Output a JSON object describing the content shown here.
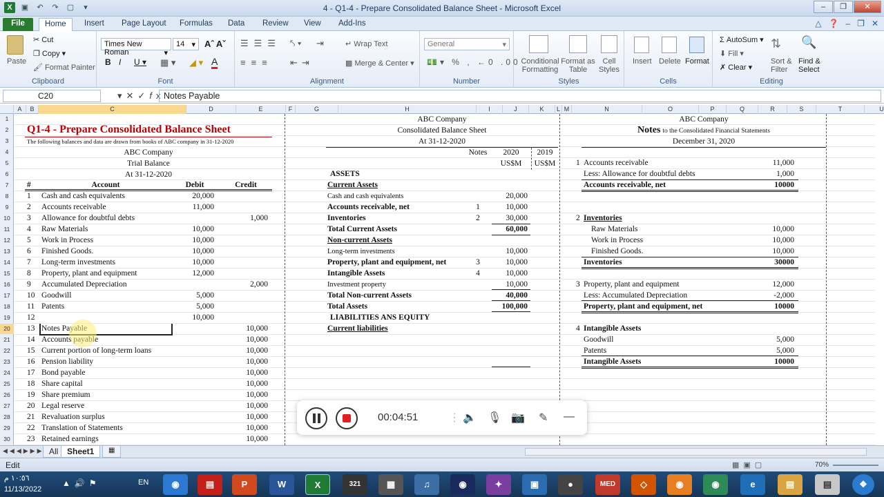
{
  "window": {
    "title": "4 - Q1-4 - Prepare Consolidated Balance Sheet  -  Microsoft Excel"
  },
  "tabs": [
    "File",
    "Home",
    "Insert",
    "Page Layout",
    "Formulas",
    "Data",
    "Review",
    "View",
    "Add-Ins"
  ],
  "ribbon": {
    "clipboard": {
      "label": "Clipboard",
      "paste": "Paste",
      "cut": "Cut",
      "copy": "Copy",
      "format_painter": "Format Painter"
    },
    "font": {
      "label": "Font",
      "name": "Times New Roman",
      "size": "14"
    },
    "alignment": {
      "label": "Alignment",
      "wrap_text": "Wrap Text",
      "merge_center": "Merge & Center"
    },
    "number": {
      "label": "Number",
      "format": "General"
    },
    "styles": {
      "label": "Styles",
      "conditional": "Conditional Formatting",
      "format_table": "Format as Table",
      "cell_styles": "Cell Styles"
    },
    "cells": {
      "label": "Cells",
      "insert": "Insert",
      "delete": "Delete",
      "format": "Format"
    },
    "editing": {
      "label": "Editing",
      "autosum": "AutoSum",
      "fill": "Fill",
      "clear": "Clear",
      "sort": "Sort & Filter",
      "find": "Find & Select"
    }
  },
  "formula_bar": {
    "name_box": "C20",
    "content": "Notes Payable"
  },
  "columns": [
    "A",
    "B",
    "C",
    "D",
    "E",
    "F",
    "G",
    "H",
    "I",
    "J",
    "K",
    "L",
    "M",
    "N",
    "O",
    "P",
    "Q",
    "R",
    "S",
    "T",
    "U"
  ],
  "rows": [
    "1",
    "2",
    "3",
    "4",
    "5",
    "6",
    "7",
    "8",
    "9",
    "10",
    "11",
    "12",
    "13",
    "14",
    "15",
    "16",
    "17",
    "18",
    "19",
    "20",
    "21",
    "22",
    "23",
    "24",
    "25",
    "26",
    "27",
    "28",
    "29",
    "30"
  ],
  "trial_balance": {
    "title": "Q1-4 - Prepare Consolidated Balance Sheet",
    "subtitle": "The following balances and data are drawn from books of ABC company in 31-12-2020",
    "company": "ABC Company",
    "heading": "Trial Balance",
    "date": "At 31-12-2020",
    "headers": {
      "num": "#",
      "account": "Account",
      "debit": "Debit",
      "credit": "Credit"
    },
    "rows": [
      {
        "n": "1",
        "account": "Cash and cash equivalents",
        "debit": "20,000",
        "credit": ""
      },
      {
        "n": "2",
        "account": "Accounts receivable",
        "debit": "11,000",
        "credit": ""
      },
      {
        "n": "3",
        "account": "Allowance for doubtful debts",
        "debit": "",
        "credit": "1,000"
      },
      {
        "n": "4",
        "account": "Raw Materials",
        "debit": "10,000",
        "credit": ""
      },
      {
        "n": "5",
        "account": "Work in Process",
        "debit": "10,000",
        "credit": ""
      },
      {
        "n": "6",
        "account": "Finished Goods.",
        "debit": "10,000",
        "credit": ""
      },
      {
        "n": "7",
        "account": "Long-term investments",
        "debit": "10,000",
        "credit": ""
      },
      {
        "n": "8",
        "account": "Property, plant and equipment",
        "debit": "12,000",
        "credit": ""
      },
      {
        "n": "9",
        "account": "Accumulated Depreciation",
        "debit": "",
        "credit": "2,000"
      },
      {
        "n": "10",
        "account": "Goodwill",
        "debit": "5,000",
        "credit": ""
      },
      {
        "n": "11",
        "account": "Patents",
        "debit": "5,000",
        "credit": ""
      },
      {
        "n": "12",
        "account": "",
        "debit": "10,000",
        "credit": ""
      },
      {
        "n": "13",
        "account": "Notes Payable",
        "debit": "",
        "credit": "10,000"
      },
      {
        "n": "14",
        "account": "Accounts payable",
        "debit": "",
        "credit": "10,000"
      },
      {
        "n": "15",
        "account": "Current portion of long-term loans",
        "debit": "",
        "credit": "10,000"
      },
      {
        "n": "16",
        "account": "Pension liability",
        "debit": "",
        "credit": "10,000"
      },
      {
        "n": "17",
        "account": "Bond payable",
        "debit": "",
        "credit": "10,000"
      },
      {
        "n": "18",
        "account": "Share capital",
        "debit": "",
        "credit": "10,000"
      },
      {
        "n": "19",
        "account": "Share premium",
        "debit": "",
        "credit": "10,000"
      },
      {
        "n": "20",
        "account": "Legal reserve",
        "debit": "",
        "credit": "10,000"
      },
      {
        "n": "21",
        "account": "Revaluation surplus",
        "debit": "",
        "credit": "10,000"
      },
      {
        "n": "22",
        "account": "Translation of Statements",
        "debit": "",
        "credit": "10,000"
      },
      {
        "n": "23",
        "account": "Retained earnings",
        "debit": "",
        "credit": "10,000"
      }
    ]
  },
  "balance_sheet": {
    "company": "ABC Company",
    "heading": "Consolidated Balance Sheet",
    "date": "At 31-12-2020",
    "col_notes": "Notes",
    "col_2020": "2020",
    "col_2019": "2019",
    "currency_2020": "US$M",
    "currency_2019": "US$M",
    "rows": [
      {
        "row": 6,
        "label": "ASSETS",
        "note": "",
        "v2020": "",
        "style": "b"
      },
      {
        "row": 7,
        "label": "Current Assets",
        "note": "",
        "v2020": "",
        "style": "bu"
      },
      {
        "row": 8,
        "label": "Cash and cash equivalents",
        "note": "",
        "v2020": "20,000",
        "style": ""
      },
      {
        "row": 9,
        "label": "Accounts receivable, net",
        "note": "1",
        "v2020": "10,000",
        "style": "b"
      },
      {
        "row": 10,
        "label": "Inventories",
        "note": "2",
        "v2020": "30,000",
        "style": "b"
      },
      {
        "row": 11,
        "label": "Total Current Assets",
        "note": "",
        "v2020": "60,000",
        "style": "b"
      },
      {
        "row": 12,
        "label": "Non-current Assets",
        "note": "",
        "v2020": "",
        "style": "bu"
      },
      {
        "row": 13,
        "label": "Long-term investments",
        "note": "",
        "v2020": "10,000",
        "style": ""
      },
      {
        "row": 14,
        "label": "Property, plant and equipment, net",
        "note": "3",
        "v2020": "10,000",
        "style": "b"
      },
      {
        "row": 15,
        "label": "Intangible Assets",
        "note": "4",
        "v2020": "10,000",
        "style": "b"
      },
      {
        "row": 16,
        "label": "Investment property",
        "note": "",
        "v2020": "10,000",
        "style": ""
      },
      {
        "row": 17,
        "label": "Total Non-current Assets",
        "note": "",
        "v2020": "40,000",
        "style": "b"
      },
      {
        "row": 18,
        "label": "Total Assets",
        "note": "",
        "v2020": "100,000",
        "style": "b"
      },
      {
        "row": 19,
        "label": "LIABILITIES ANS EQUITY",
        "note": "",
        "v2020": "",
        "style": "b"
      },
      {
        "row": 20,
        "label": "Current liabilities",
        "note": "",
        "v2020": "",
        "style": "bu"
      }
    ]
  },
  "notes": {
    "company": "ABC Company",
    "heading_bold": "Notes",
    "heading_rest": "to the Consolidated Financial Statements",
    "date": "December 31, 2020",
    "rows": [
      {
        "row": 5,
        "num": "1",
        "label": "Accounts receivable",
        "value": "11,000",
        "style": ""
      },
      {
        "row": 6,
        "num": "",
        "label": "Less: Allowance for doubtful debts",
        "value": "1,000",
        "style": ""
      },
      {
        "row": 7,
        "num": "",
        "label": "Accounts receivable, net",
        "value": "10000",
        "style": "b"
      },
      {
        "row": 10,
        "num": "2",
        "label": "Inventories",
        "value": "",
        "style": "bu"
      },
      {
        "row": 11,
        "num": "",
        "label": "Raw Materials",
        "value": "10,000",
        "style": "i"
      },
      {
        "row": 12,
        "num": "",
        "label": "Work in Process",
        "value": "10,000",
        "style": "i"
      },
      {
        "row": 13,
        "num": "",
        "label": "Finished Goods.",
        "value": "10,000",
        "style": "i"
      },
      {
        "row": 14,
        "num": "",
        "label": "Inventories",
        "value": "30000",
        "style": "b"
      },
      {
        "row": 16,
        "num": "3",
        "label": "Property, plant and equipment",
        "value": "12,000",
        "style": ""
      },
      {
        "row": 17,
        "num": "",
        "label": "Less: Accumulated Depreciation",
        "value": "-2,000",
        "style": ""
      },
      {
        "row": 18,
        "num": "",
        "label": "Property, plant and equipment, net",
        "value": "10000",
        "style": "b"
      },
      {
        "row": 20,
        "num": "4",
        "label": "Intangible Assets",
        "value": "",
        "style": "b"
      },
      {
        "row": 21,
        "num": "",
        "label": "Goodwill",
        "value": "5,000",
        "style": ""
      },
      {
        "row": 22,
        "num": "",
        "label": "Patents",
        "value": "5,000",
        "style": ""
      },
      {
        "row": 23,
        "num": "",
        "label": "Intangible Assets",
        "value": "10000",
        "style": "b"
      }
    ]
  },
  "recorder": {
    "time": "00:04:51"
  },
  "sheet_tabs": [
    "All",
    "Sheet1"
  ],
  "status": {
    "mode": "Edit",
    "zoom": "70%"
  },
  "taskbar": {
    "time": "١٠:٥٦ م",
    "date": "11/13/2022",
    "lang": "EN",
    "badge": "321"
  }
}
